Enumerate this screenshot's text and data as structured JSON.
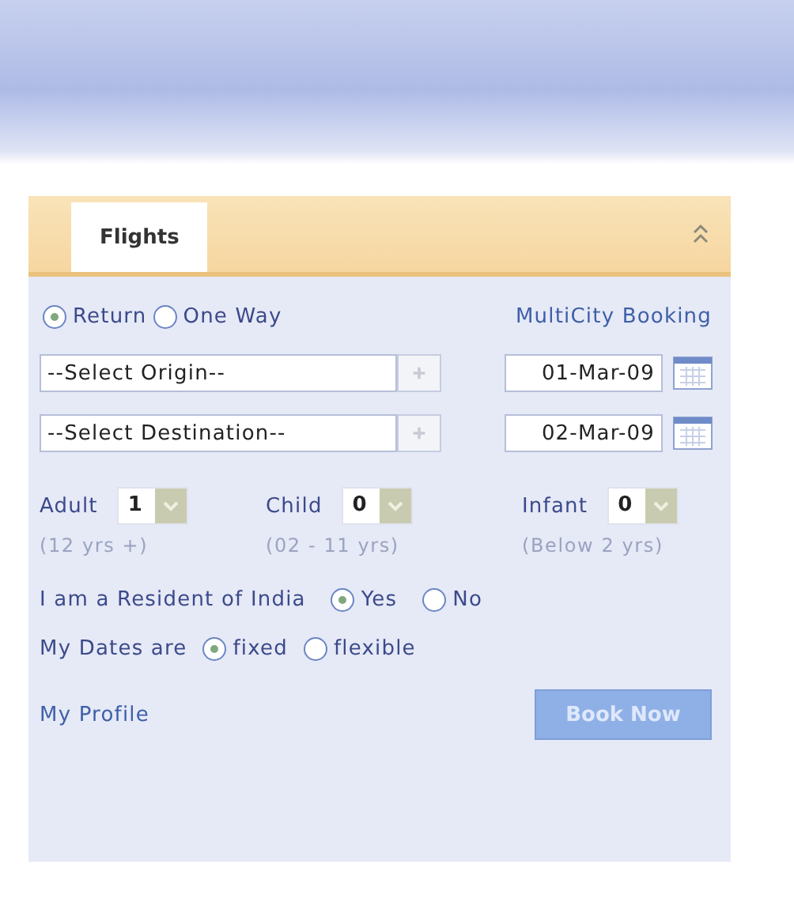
{
  "tabs": [
    {
      "label": "Flights",
      "selected": true
    }
  ],
  "trip_type": [
    {
      "label": "Return",
      "selected": true
    },
    {
      "label": "One Way",
      "selected": false
    }
  ],
  "multicity_link": "MultiCity Booking",
  "routes": [
    {
      "place": "--Select Origin--",
      "date": "01-Mar-09"
    },
    {
      "place": "--Select Destination--",
      "date": "02-Mar-09"
    }
  ],
  "passengers": [
    {
      "label": "Adult",
      "value": "1",
      "hint": "(12 yrs +)"
    },
    {
      "label": "Child",
      "value": "0",
      "hint": "(02 - 11 yrs)"
    },
    {
      "label": "Infant",
      "value": "0",
      "hint": "(Below 2 yrs)"
    }
  ],
  "resident": {
    "label": "I am a Resident of India",
    "options": [
      {
        "label": "Yes",
        "selected": true
      },
      {
        "label": "No",
        "selected": false
      }
    ]
  },
  "dates": {
    "label": "My Dates are",
    "options": [
      {
        "label": "fixed",
        "selected": true
      },
      {
        "label": "flexible",
        "selected": false
      }
    ]
  },
  "profile_link": "My Profile",
  "book_button": "Book Now"
}
